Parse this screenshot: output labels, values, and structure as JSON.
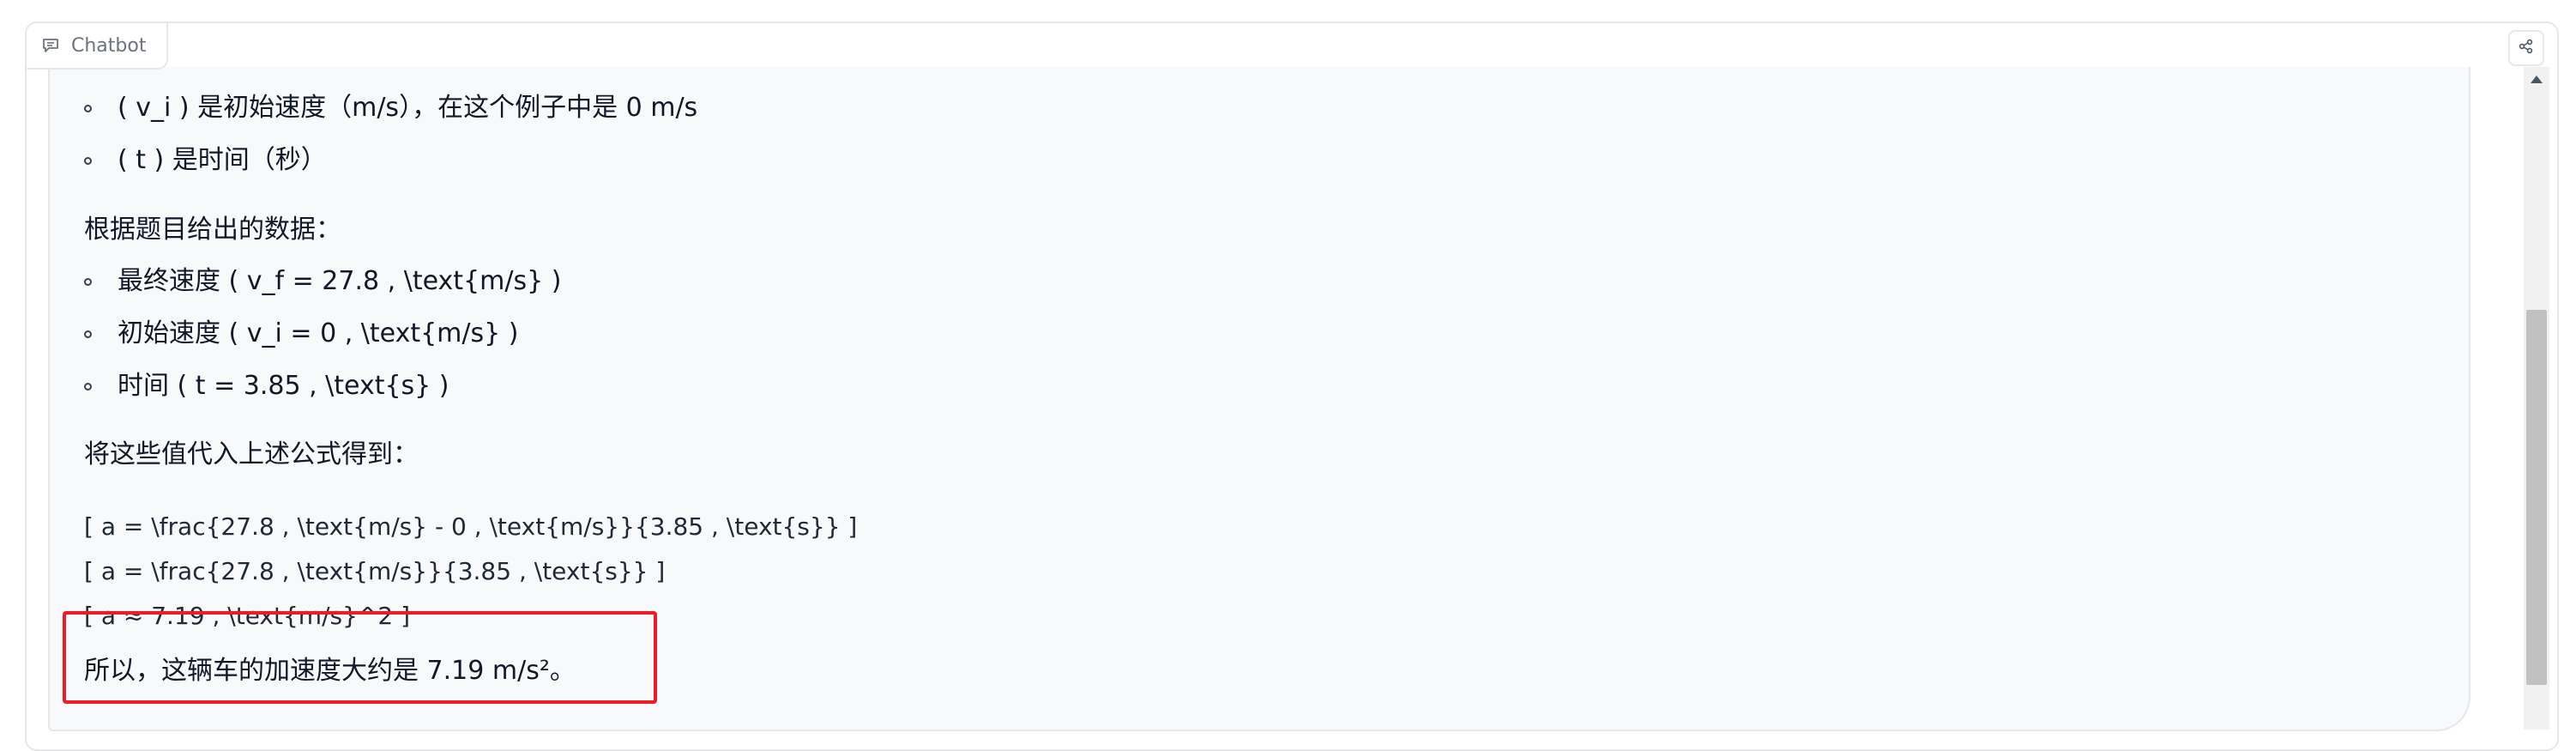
{
  "header": {
    "chatbot_label": "Chatbot",
    "chatbot_icon": "chat-icon",
    "share_icon": "share-icon"
  },
  "message": {
    "bullets_top": [
      "( v_i ) 是初始速度（m/s），在这个例子中是 0 m/s",
      "( t ) 是时间（秒）"
    ],
    "given_heading": "根据题目给出的数据：",
    "given_items": [
      "最终速度 ( v_f = 27.8 , \\text{m/s} )",
      "初始速度 ( v_i = 0 , \\text{m/s} )",
      "时间 ( t = 3.85 , \\text{s} )"
    ],
    "substitute_heading": "将这些值代入上述公式得到：",
    "equations": [
      "[ a = \\frac{27.8 , \\text{m/s} - 0 , \\text{m/s}}{3.85 , \\text{s}} ]",
      "[ a = \\frac{27.8 , \\text{m/s}}{3.85 , \\text{s}} ]",
      "[ a ≈ 7.19 , \\text{m/s}^2 ]"
    ],
    "conclusion": "所以，这辆车的加速度大约是 7.19 m/s²。"
  },
  "colors": {
    "highlight": "#ee1c25",
    "message_bg": "#f8f9fb",
    "border": "#e5e7eb"
  }
}
